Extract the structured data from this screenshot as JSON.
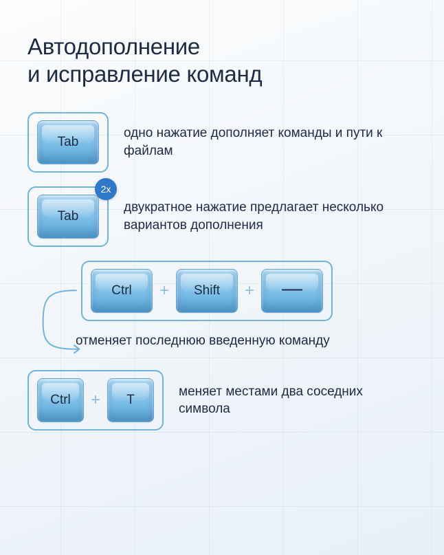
{
  "title": "Автодополнение\nи исправление команд",
  "items": [
    {
      "keys": [
        "Tab"
      ],
      "badge": null,
      "desc": "одно нажатие дополняет команды и пути к файлам"
    },
    {
      "keys": [
        "Tab"
      ],
      "badge": "2x",
      "desc": "двукратное нажатие предлагает несколько вариантов дополнения"
    },
    {
      "keys": [
        "Ctrl",
        "Shift",
        "—"
      ],
      "badge": null,
      "desc": "отменяет последнюю введенную команду"
    },
    {
      "keys": [
        "Ctrl",
        "T"
      ],
      "badge": null,
      "desc": "меняет местами два соседних символа"
    }
  ],
  "plus": "+"
}
